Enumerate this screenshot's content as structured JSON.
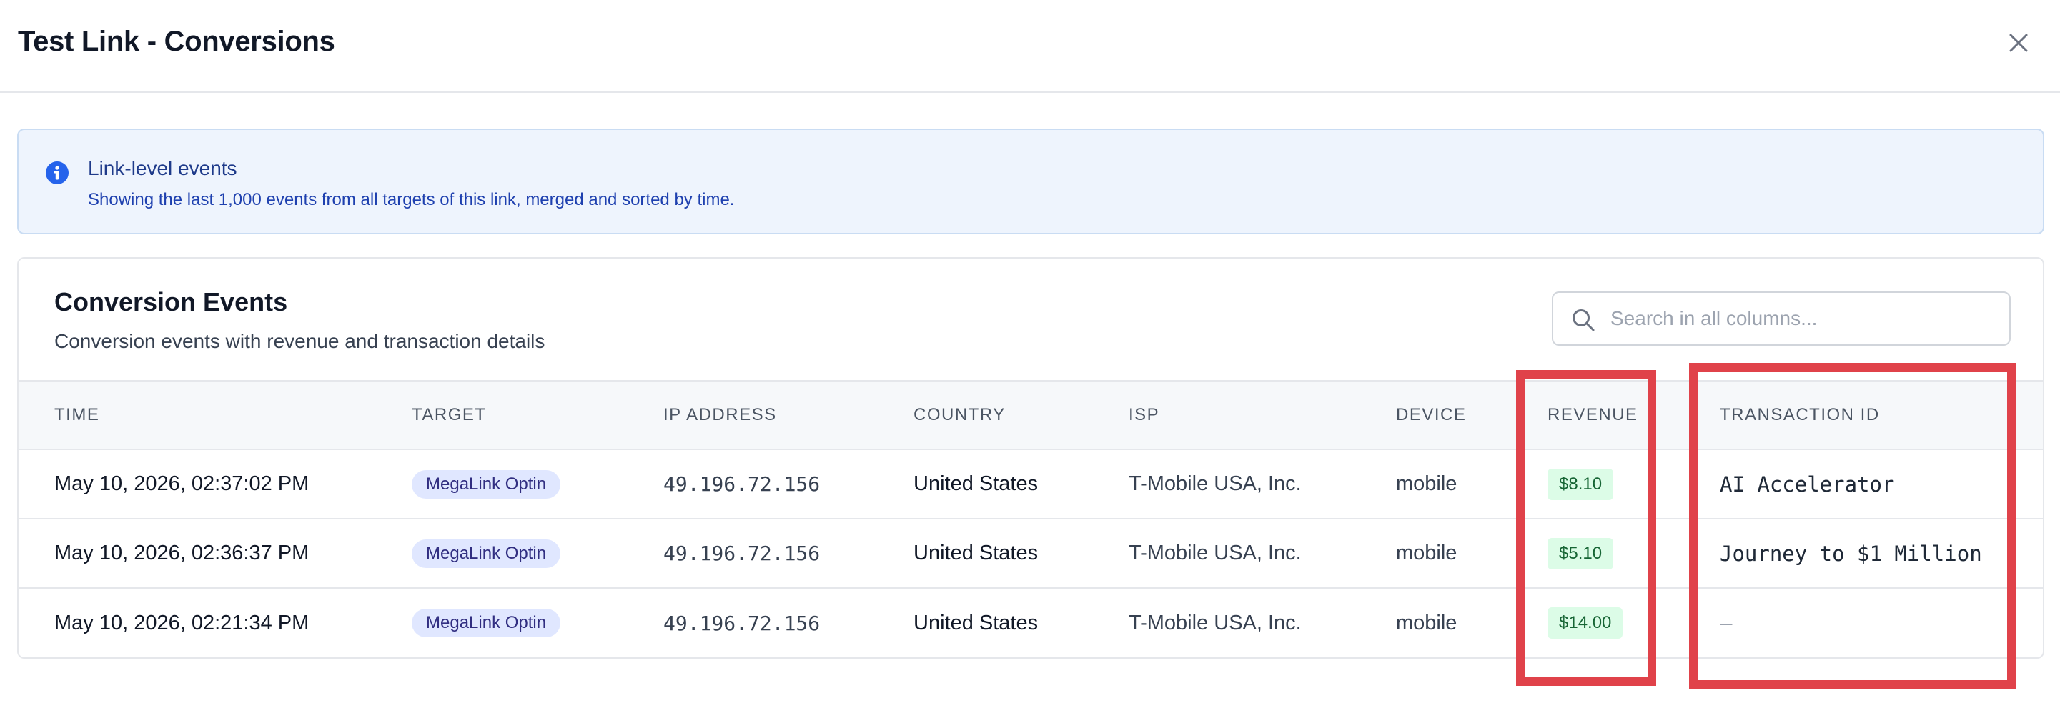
{
  "dialog": {
    "title": "Test Link - Conversions"
  },
  "info": {
    "title": "Link-level events",
    "text": "Showing the last 1,000 events from all targets of this link, merged and sorted by time."
  },
  "card": {
    "title": "Conversion Events",
    "subtitle": "Conversion events with revenue and transaction details"
  },
  "search": {
    "placeholder": "Search in all columns..."
  },
  "table": {
    "headers": {
      "time": "TIME",
      "target": "TARGET",
      "ip": "IP ADDRESS",
      "country": "COUNTRY",
      "isp": "ISP",
      "device": "DEVICE",
      "revenue": "REVENUE",
      "transaction": "TRANSACTION ID"
    },
    "rows": [
      {
        "time": "May 10, 2026, 02:37:02 PM",
        "target": "MegaLink Optin",
        "ip": "49.196.72.156",
        "country": "United States",
        "isp": "T-Mobile USA, Inc.",
        "device": "mobile",
        "revenue": "$8.10",
        "transaction": "AI Accelerator"
      },
      {
        "time": "May 10, 2026, 02:36:37 PM",
        "target": "MegaLink Optin",
        "ip": "49.196.72.156",
        "country": "United States",
        "isp": "T-Mobile USA, Inc.",
        "device": "mobile",
        "revenue": "$5.10",
        "transaction": "Journey to $1 Million"
      },
      {
        "time": "May 10, 2026, 02:21:34 PM",
        "target": "MegaLink Optin",
        "ip": "49.196.72.156",
        "country": "United States",
        "isp": "T-Mobile USA, Inc.",
        "device": "mobile",
        "revenue": "$14.00",
        "transaction": "—"
      }
    ]
  },
  "icons": {
    "close": "close-icon",
    "info": "info-icon",
    "search": "search-icon"
  },
  "colors": {
    "info_bg": "#eef4fd",
    "info_accent": "#2563eb",
    "target_badge_bg": "#e0e7ff",
    "revenue_badge_bg": "#dcfce7",
    "highlight_border": "#e0424a"
  }
}
